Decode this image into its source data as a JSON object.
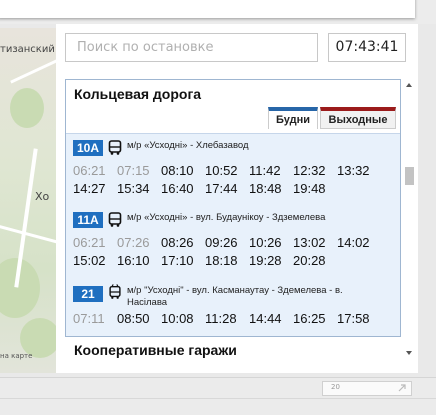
{
  "search": {
    "placeholder": "Поиск по остановке"
  },
  "clock": "07:43:41",
  "map": {
    "labels": [
      "тизанский",
      "Хо",
      "на карте"
    ]
  },
  "stop": {
    "title": "Кольцевая дорога",
    "tabs": [
      {
        "label": "Будни",
        "active": true,
        "color": "#2766a8"
      },
      {
        "label": "Выходные",
        "active": false,
        "color": "#9b1b1b"
      }
    ]
  },
  "routes": [
    {
      "number": "10А",
      "icon": "bus-icon",
      "name": "м/р «Усходні» - Хлебазавод",
      "past_times": [
        "06:21",
        "07:15"
      ],
      "times": [
        "08:10",
        "10:52",
        "11:42",
        "12:32",
        "13:32",
        "14:27",
        "15:34",
        "16:40",
        "17:44",
        "18:48",
        "19:48"
      ]
    },
    {
      "number": "11А",
      "icon": "bus-icon",
      "name": "м/р «Усходні» - вул. Будаунікоу - Здземелева",
      "past_times": [
        "06:21",
        "07:26"
      ],
      "times": [
        "08:26",
        "09:26",
        "10:26",
        "13:02",
        "14:02",
        "15:02",
        "16:10",
        "17:10",
        "18:18",
        "19:28",
        "20:28"
      ]
    },
    {
      "number": "21",
      "icon": "trolleybus-icon",
      "name_line1": "м/р \"Усходні\" - вул. Касманаутау - Здемелева - в.",
      "name_line2": "Насілава",
      "past_times": [
        "07:11"
      ],
      "times": [
        "08:50",
        "10:08",
        "11:28",
        "14:44",
        "16:25",
        "17:58"
      ]
    }
  ],
  "next_stop": {
    "title": "Кооперативные гаражи"
  },
  "footer": {
    "scale": "20"
  },
  "colors": {
    "badge": "#1f6fc0",
    "panel_bg": "#e8f1fb",
    "tab_weekdays": "#2766a8",
    "tab_weekends": "#9b1b1b"
  }
}
